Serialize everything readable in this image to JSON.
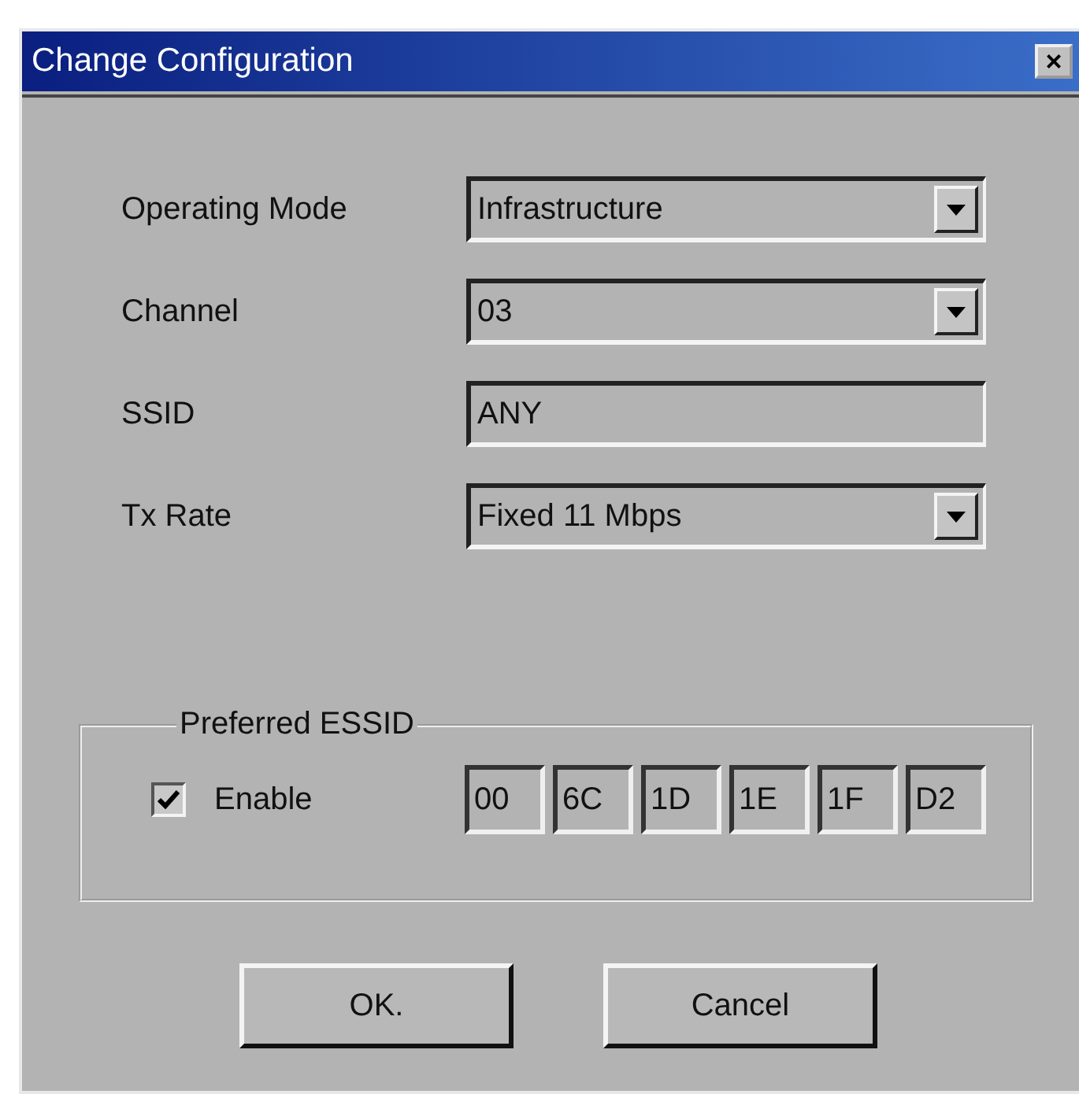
{
  "window": {
    "title": "Change Configuration",
    "close": "×"
  },
  "fields": [
    {
      "kind": "dropdown",
      "label": "Operating Mode",
      "value": "Infrastructure"
    },
    {
      "kind": "dropdown",
      "label": "Channel",
      "value": "03"
    },
    {
      "kind": "text",
      "label": "SSID",
      "value": "ANY"
    },
    {
      "kind": "dropdown",
      "label": "Tx Rate",
      "value": "Fixed 11 Mbps"
    }
  ],
  "group": {
    "title": "Preferred ESSID",
    "enable": {
      "label": "Enable",
      "checked": true
    },
    "bytes": [
      "00",
      "6C",
      "1D",
      "1E",
      "1F",
      "D2"
    ]
  },
  "buttons": [
    "OK.",
    "Cancel"
  ]
}
